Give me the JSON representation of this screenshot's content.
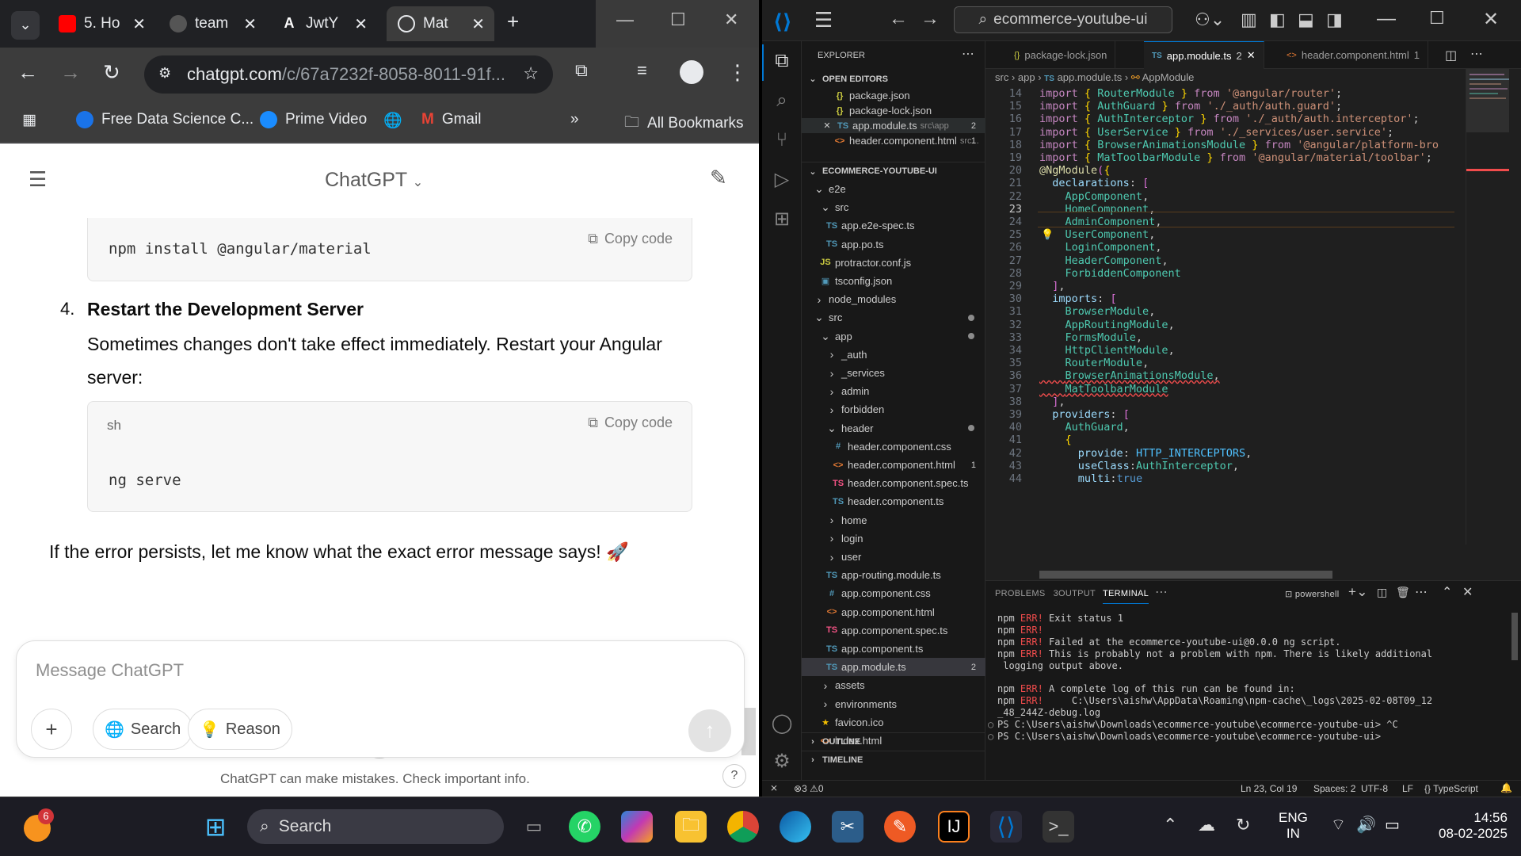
{
  "browser": {
    "tabs": [
      {
        "label": "5. Ho"
      },
      {
        "label": "team"
      },
      {
        "label": "JwtY"
      },
      {
        "label": "Mat"
      }
    ],
    "url_host": "chatgpt.com",
    "url_path": "/c/67a7232f-8058-8011-91f...",
    "bookmarks": [
      "Free Data Science C...",
      "Prime Video",
      "Gmail",
      "All Bookmarks"
    ]
  },
  "chat": {
    "title": "ChatGPT",
    "code1": "npm install @angular/material",
    "copy_label": "Copy code",
    "step_num": "4.",
    "step_title": "Restart the Development Server",
    "step_text_1": "Sometimes changes don't take effect immediately. Restart your Angular",
    "step_text_2": "server:",
    "code2_lang": "sh",
    "code2": "ng serve",
    "closing": "If the error persists, let me know what the exact error message says! 🚀",
    "placeholder": "Message ChatGPT",
    "search_btn": "Search",
    "reason_btn": "Reason",
    "disclaimer": "ChatGPT can make mistakes. Check important info.",
    "help": "?"
  },
  "vscode": {
    "search": "ecommerce-youtube-ui",
    "explorer_title": "EXPLORER",
    "open_editors": "OPEN EDITORS",
    "open_files": [
      {
        "name": "package.json",
        "type": "json"
      },
      {
        "name": "package-lock.json",
        "type": "json"
      },
      {
        "name": "app.module.ts",
        "path": "src\\app",
        "badge": "2",
        "type": "ts"
      },
      {
        "name": "header.component.html",
        "path": "src...",
        "badge": "1",
        "type": "html"
      }
    ],
    "project": "ECOMMERCE-YOUTUBE-UI",
    "tree": [
      {
        "n": "e2e",
        "d": 1,
        "t": "folder",
        "open": true
      },
      {
        "n": "src",
        "d": 2,
        "t": "folder",
        "open": true
      },
      {
        "n": "app.e2e-spec.ts",
        "d": 3,
        "t": "ts"
      },
      {
        "n": "app.po.ts",
        "d": 3,
        "t": "ts"
      },
      {
        "n": "protractor.conf.js",
        "d": 2,
        "t": "js"
      },
      {
        "n": "tsconfig.json",
        "d": 2,
        "t": "tsconfig"
      },
      {
        "n": "node_modules",
        "d": 1,
        "t": "folder"
      },
      {
        "n": "src",
        "d": 1,
        "t": "folder",
        "open": true,
        "dot": true
      },
      {
        "n": "app",
        "d": 2,
        "t": "folder",
        "open": true,
        "dot": true
      },
      {
        "n": "_auth",
        "d": 3,
        "t": "folder"
      },
      {
        "n": "_services",
        "d": 3,
        "t": "folder"
      },
      {
        "n": "admin",
        "d": 3,
        "t": "folder"
      },
      {
        "n": "forbidden",
        "d": 3,
        "t": "folder"
      },
      {
        "n": "header",
        "d": 3,
        "t": "folder",
        "open": true,
        "dot": true
      },
      {
        "n": "header.component.css",
        "d": 4,
        "t": "css"
      },
      {
        "n": "header.component.html",
        "d": 4,
        "t": "html",
        "badge": "1"
      },
      {
        "n": "header.component.spec.ts",
        "d": 4,
        "t": "spec"
      },
      {
        "n": "header.component.ts",
        "d": 4,
        "t": "ts"
      },
      {
        "n": "home",
        "d": 3,
        "t": "folder"
      },
      {
        "n": "login",
        "d": 3,
        "t": "folder"
      },
      {
        "n": "user",
        "d": 3,
        "t": "folder"
      },
      {
        "n": "app-routing.module.ts",
        "d": 3,
        "t": "ts"
      },
      {
        "n": "app.component.css",
        "d": 3,
        "t": "css"
      },
      {
        "n": "app.component.html",
        "d": 3,
        "t": "html"
      },
      {
        "n": "app.component.spec.ts",
        "d": 3,
        "t": "spec"
      },
      {
        "n": "app.component.ts",
        "d": 3,
        "t": "ts"
      },
      {
        "n": "app.module.ts",
        "d": 3,
        "t": "ts",
        "badge": "2",
        "sel": true
      },
      {
        "n": "assets",
        "d": 2,
        "t": "folder"
      },
      {
        "n": "environments",
        "d": 2,
        "t": "folder"
      },
      {
        "n": "favicon.ico",
        "d": 2,
        "t": "star"
      },
      {
        "n": "index.html",
        "d": 2,
        "t": "html"
      }
    ],
    "outline": "OUTLINE",
    "timeline": "TIMELINE",
    "editor_tabs": [
      {
        "name": "package-lock.json",
        "type": "json"
      },
      {
        "name": "app.module.ts",
        "badge": "2",
        "type": "ts",
        "active": true
      },
      {
        "name": "header.component.html",
        "badge": "1",
        "type": "html"
      }
    ],
    "breadcrumb": [
      "src",
      "app",
      "app.module.ts",
      "AppModule"
    ],
    "code": [
      {
        "n": "14",
        "c": "import { RouterModule } from '@angular/router';"
      },
      {
        "n": "15",
        "c": "import { AuthGuard } from './_auth/auth.guard';"
      },
      {
        "n": "16",
        "c": "import { AuthInterceptor } from './_auth/auth.interceptor';"
      },
      {
        "n": "17",
        "c": "import { UserService } from './_services/user.service';"
      },
      {
        "n": "18",
        "c": "import { BrowserAnimationsModule } from '@angular/platform-bro"
      },
      {
        "n": "19",
        "c": "import { MatToolbarModule } from '@angular/material/toolbar';"
      },
      {
        "n": "20",
        "c": "@NgModule({"
      },
      {
        "n": "21",
        "c": "  declarations: ["
      },
      {
        "n": "22",
        "c": "    AppComponent,"
      },
      {
        "n": "23",
        "c": "    HomeComponent,"
      },
      {
        "n": "24",
        "c": "    AdminComponent,"
      },
      {
        "n": "25",
        "c": "    UserComponent,"
      },
      {
        "n": "26",
        "c": "    LoginComponent,"
      },
      {
        "n": "27",
        "c": "    HeaderComponent,"
      },
      {
        "n": "28",
        "c": "    ForbiddenComponent"
      },
      {
        "n": "29",
        "c": "  ],"
      },
      {
        "n": "30",
        "c": "  imports: ["
      },
      {
        "n": "31",
        "c": "    BrowserModule,"
      },
      {
        "n": "32",
        "c": "    AppRoutingModule,"
      },
      {
        "n": "33",
        "c": "    FormsModule,"
      },
      {
        "n": "34",
        "c": "    HttpClientModule,"
      },
      {
        "n": "35",
        "c": "    RouterModule,"
      },
      {
        "n": "36",
        "c": "    BrowserAnimationsModule,"
      },
      {
        "n": "37",
        "c": "    MatToolbarModule"
      },
      {
        "n": "38",
        "c": "  ],"
      },
      {
        "n": "39",
        "c": "  providers: ["
      },
      {
        "n": "40",
        "c": "    AuthGuard,"
      },
      {
        "n": "41",
        "c": "    {"
      },
      {
        "n": "42",
        "c": "      provide: HTTP_INTERCEPTORS,"
      },
      {
        "n": "43",
        "c": "      useClass:AuthInterceptor,"
      },
      {
        "n": "44",
        "c": "      multi:true"
      }
    ],
    "panel_tabs": [
      "PROBLEMS",
      "OUTPUT",
      "TERMINAL"
    ],
    "problems_count": "3",
    "shell": "powershell",
    "terminal": [
      {
        "p": "npm ",
        "e": "ERR!",
        "r": " Exit status 1"
      },
      {
        "p": "npm ",
        "e": "ERR!",
        "r": ""
      },
      {
        "p": "npm ",
        "e": "ERR!",
        "r": " Failed at the ecommerce-youtube-ui@0.0.0 ng script."
      },
      {
        "p": "npm ",
        "e": "ERR!",
        "r": " This is probably not a problem with npm. There is likely additional"
      },
      {
        "p": "",
        "e": "",
        "r": " logging output above."
      },
      {
        "p": "",
        "e": "",
        "r": ""
      },
      {
        "p": "npm ",
        "e": "ERR!",
        "r": " A complete log of this run can be found in:"
      },
      {
        "p": "npm ",
        "e": "ERR!",
        "r": "     C:\\Users\\aishw\\AppData\\Roaming\\npm-cache\\_logs\\2025-02-08T09_12"
      },
      {
        "p": "",
        "e": "",
        "r": "_48_244Z-debug.log"
      },
      {
        "p": "PS ",
        "e": "",
        "r": "C:\\Users\\aishw\\Downloads\\ecommerce-youtube\\ecommerce-youtube-ui> ^C"
      },
      {
        "p": "PS ",
        "e": "",
        "r": "C:\\Users\\aishw\\Downloads\\ecommerce-youtube\\ecommerce-youtube-ui> "
      }
    ],
    "status": {
      "problems": "3",
      "warnings": "0",
      "pos": "Ln 23, Col 19",
      "spaces": "Spaces: 2",
      "enc": "UTF-8",
      "eol": "LF",
      "lang": "TypeScript"
    }
  },
  "taskbar": {
    "search": "Search",
    "badge": "6",
    "lang1": "ENG",
    "lang2": "IN",
    "time": "14:56",
    "date": "08-02-2025"
  }
}
